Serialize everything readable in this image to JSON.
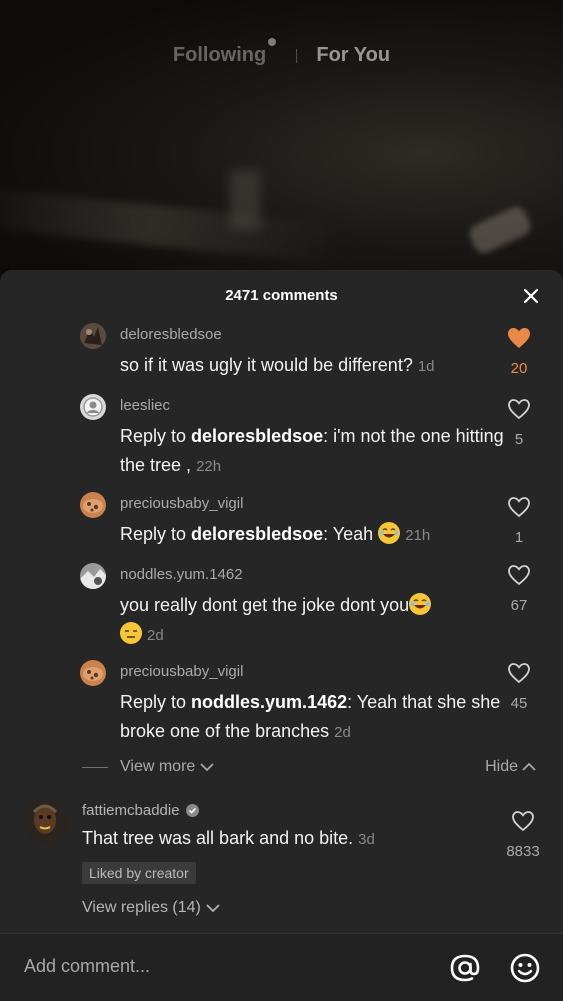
{
  "top_tabs": {
    "following": "Following",
    "for_you": "For You"
  },
  "comments_header": {
    "title": "2471 comments"
  },
  "replies": [
    {
      "username": "deloresbledsoe",
      "text": "so if it was ugly it would be different?",
      "time": "1d",
      "likes": "20",
      "liked": true
    },
    {
      "username": "leesliec",
      "reply_prefix": "Reply to ",
      "reply_to": "deloresbledsoe",
      "text": ": i'm not the one hitting the tree ,",
      "time": "22h",
      "likes": "5",
      "liked": false
    },
    {
      "username": "preciousbaby_vigil",
      "reply_prefix": "Reply to ",
      "reply_to": "deloresbledsoe",
      "text": ": Yeah",
      "time": "21h",
      "likes": "1",
      "liked": false
    },
    {
      "username": "noddles.yum.1462",
      "text": "you really dont get the joke dont you",
      "time": "2d",
      "likes": "67",
      "liked": false
    },
    {
      "username": "preciousbaby_vigil",
      "reply_prefix": "Reply to ",
      "reply_to": "noddles.yum.1462",
      "text": ": Yeah that she she broke one of the branches",
      "time": "2d",
      "likes": "45",
      "liked": false
    }
  ],
  "thread_controls": {
    "view_more": "View more",
    "hide": "Hide"
  },
  "main_comment": {
    "username": "fattiemcbaddie",
    "text": "That tree was all bark and no bite.",
    "time": "3d",
    "likes": "8833",
    "liked_by": "Liked by creator",
    "view_replies": "View replies (14)"
  },
  "input": {
    "placeholder": "Add comment..."
  },
  "colors": {
    "sheet_bg": "#262626",
    "liked_heart": "#e8894a",
    "emoji_yellow": "#f7c53a"
  },
  "icons": [
    "close-icon",
    "heart-icon",
    "heart-filled-icon",
    "chevron-down-icon",
    "chevron-up-icon",
    "verified-icon",
    "at-icon",
    "emoji-icon"
  ]
}
